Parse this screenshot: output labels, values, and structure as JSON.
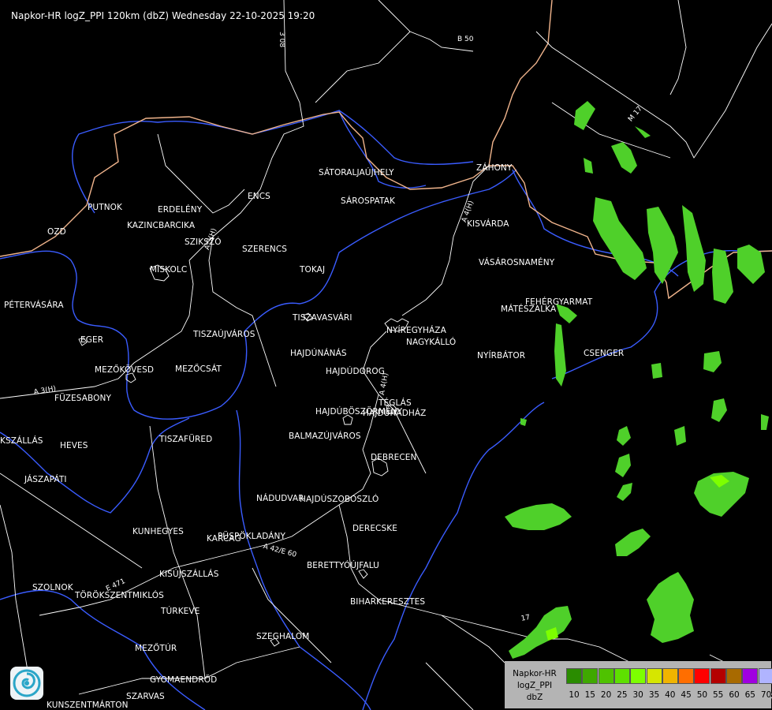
{
  "header": {
    "title": "Napkor-HR logZ_PPI 120km (dbZ) Wednesday 22-10-2025 19:20"
  },
  "cities": [
    {
      "name": "SÁTORALJAÚJHELY"
    },
    {
      "name": "SÁROSPATAK"
    },
    {
      "name": "ZÁHONY"
    },
    {
      "name": "PUTNOK"
    },
    {
      "name": "ERDELÉNY"
    },
    {
      "name": "ENCS"
    },
    {
      "name": "OZD"
    },
    {
      "name": "KAZINCBARCIKA"
    },
    {
      "name": "SZIKSZÓ"
    },
    {
      "name": "SZERENCS"
    },
    {
      "name": "KISVÁRDA"
    },
    {
      "name": "VÁSÁROSNAMÉNY"
    },
    {
      "name": "MISKOLC"
    },
    {
      "name": "TOKAJ"
    },
    {
      "name": "PÉTERVÁSÁRA"
    },
    {
      "name": "FEHÉRGYARMAT"
    },
    {
      "name": "MÁTÉSZALKA"
    },
    {
      "name": "TISZAVASVÁRI"
    },
    {
      "name": "NYÍREGYHÁZA"
    },
    {
      "name": "EGER"
    },
    {
      "name": "TISZAÚJVÁROS"
    },
    {
      "name": "NAGYKÁLLÓ"
    },
    {
      "name": "HAJDÚNÁNÁS"
    },
    {
      "name": "NYÍRBÁTOR"
    },
    {
      "name": "CSENGER"
    },
    {
      "name": "MEZŐKÖVESD"
    },
    {
      "name": "MEZŐCSÁT"
    },
    {
      "name": "HAJDÚDOROG"
    },
    {
      "name": "FÜZESABONY"
    },
    {
      "name": "TÉGLÁS"
    },
    {
      "name": "HAJDÚBÖSZÖRMÉNY"
    },
    {
      "name": "HAJDÚHADHÁZ"
    },
    {
      "name": "KSZÁLLÁS"
    },
    {
      "name": "TISZAFÜRED"
    },
    {
      "name": "BALMAZÚJVÁROS"
    },
    {
      "name": "HEVES"
    },
    {
      "name": "DEBRECEN"
    },
    {
      "name": "JÁSZAPÁTI"
    },
    {
      "name": "NÁDUDVAR"
    },
    {
      "name": "HAJDÚSZOBOSZLÓ"
    },
    {
      "name": "DERECSKE"
    },
    {
      "name": "KUNHEGYES"
    },
    {
      "name": "KARCAG"
    },
    {
      "name": "PÜSPÖKLADÁNY"
    },
    {
      "name": "BERETTYÓÚJFALU"
    },
    {
      "name": "KISÚJSZÁLLÁS"
    },
    {
      "name": "SZOLNOK"
    },
    {
      "name": "TÖRÖKSZENTMIKLÓS"
    },
    {
      "name": "BIHARKERESZTES"
    },
    {
      "name": "TÚRKEVE"
    },
    {
      "name": "SZEGHALOM"
    },
    {
      "name": "MEZŐTÚR"
    },
    {
      "name": "GYOMAENDRŐD"
    },
    {
      "name": "SZARVAS"
    },
    {
      "name": "KUNSZENTMÁRTON"
    }
  ],
  "roads": [
    {
      "name": "B 50"
    },
    {
      "name": "M 17"
    },
    {
      "name": "3 08"
    },
    {
      "name": "A 3(H)"
    },
    {
      "name": "A 4(H)"
    },
    {
      "name": "A 3(H)"
    },
    {
      "name": "A 4(H)"
    },
    {
      "name": "A 42/E 60"
    },
    {
      "name": "E 471"
    },
    {
      "name": "17"
    },
    {
      "name": "17"
    }
  ],
  "legend": {
    "title_lines": [
      "Napkor-HR",
      "logZ_PPI",
      "dbZ"
    ],
    "levels": [
      {
        "value": "10",
        "color": "#2a8c00"
      },
      {
        "value": "15",
        "color": "#3fa800"
      },
      {
        "value": "20",
        "color": "#4fc200"
      },
      {
        "value": "25",
        "color": "#5ee000"
      },
      {
        "value": "30",
        "color": "#7dff00"
      },
      {
        "value": "35",
        "color": "#d6e600"
      },
      {
        "value": "40",
        "color": "#f0b400"
      },
      {
        "value": "45",
        "color": "#ff6e00"
      },
      {
        "value": "50",
        "color": "#ff0000"
      },
      {
        "value": "55",
        "color": "#b40000"
      },
      {
        "value": "60",
        "color": "#a86a00"
      },
      {
        "value": "65",
        "color": "#a000e0"
      },
      {
        "value": "70",
        "color": "#b0b4ff"
      }
    ]
  },
  "colors": {
    "background": "#000000",
    "borders": "#ffffff",
    "rivers": "#3a5cff",
    "state_border": "#f0b48c",
    "echo": "#4fd02a"
  },
  "logo": {
    "icon": "cyclone-logo-icon"
  }
}
